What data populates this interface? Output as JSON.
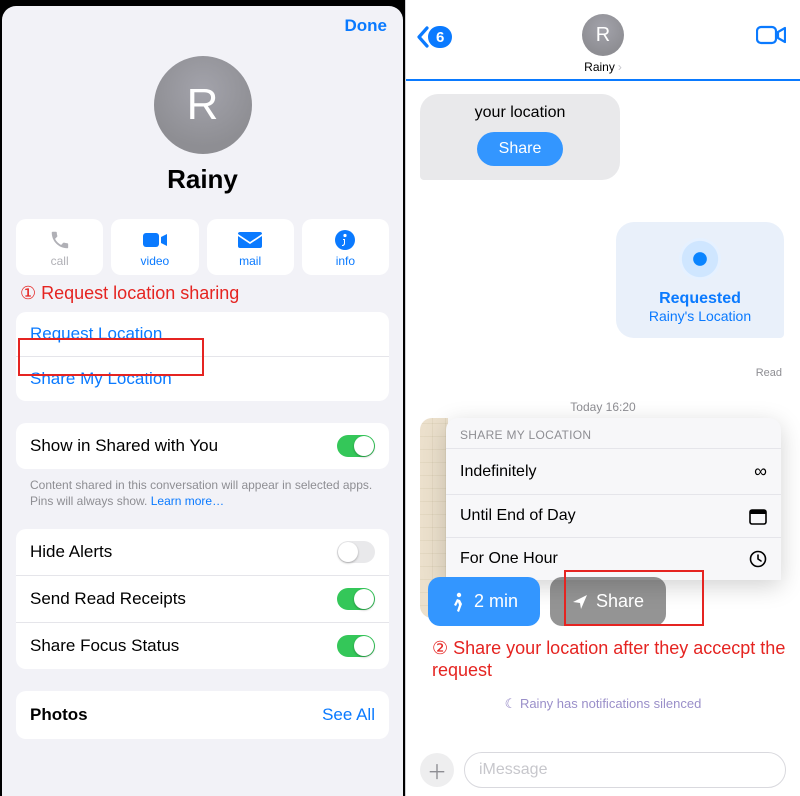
{
  "left": {
    "done": "Done",
    "avatar_initial": "R",
    "contact_name": "Rainy",
    "actions": {
      "call": "call",
      "video": "video",
      "mail": "mail",
      "info": "info"
    },
    "annotation1": "① Request location sharing",
    "location_group": {
      "request": "Request Location",
      "share": "Share My Location"
    },
    "shared_with_you": {
      "label": "Show in Shared with You",
      "note_a": "Content shared in this conversation will appear in selected apps. Pins will always show. ",
      "learn_more": "Learn more…"
    },
    "toggles": {
      "hide_alerts": "Hide Alerts",
      "read_receipts": "Send Read Receipts",
      "focus_status": "Share Focus Status"
    },
    "photos": {
      "label": "Photos",
      "see_all": "See All"
    }
  },
  "right": {
    "back_count": "6",
    "avatar_initial": "R",
    "contact_name": "Rainy",
    "incoming_text": "your location",
    "incoming_share": "Share",
    "outgoing": {
      "title": "Requested",
      "subtitle": "Rainy's Location"
    },
    "read": "Read",
    "timestamp": "Today 16:20",
    "share_panel": {
      "title": "SHARE MY LOCATION",
      "opt1": "Indefinitely",
      "opt2": "Until End of Day",
      "opt3": "For One Hour"
    },
    "walk_pill": "2 min",
    "share_pill": "Share",
    "annotation2": "② Share your location after they accecpt the request",
    "silenced": "Rainy has notifications silenced",
    "compose_placeholder": "iMessage"
  }
}
